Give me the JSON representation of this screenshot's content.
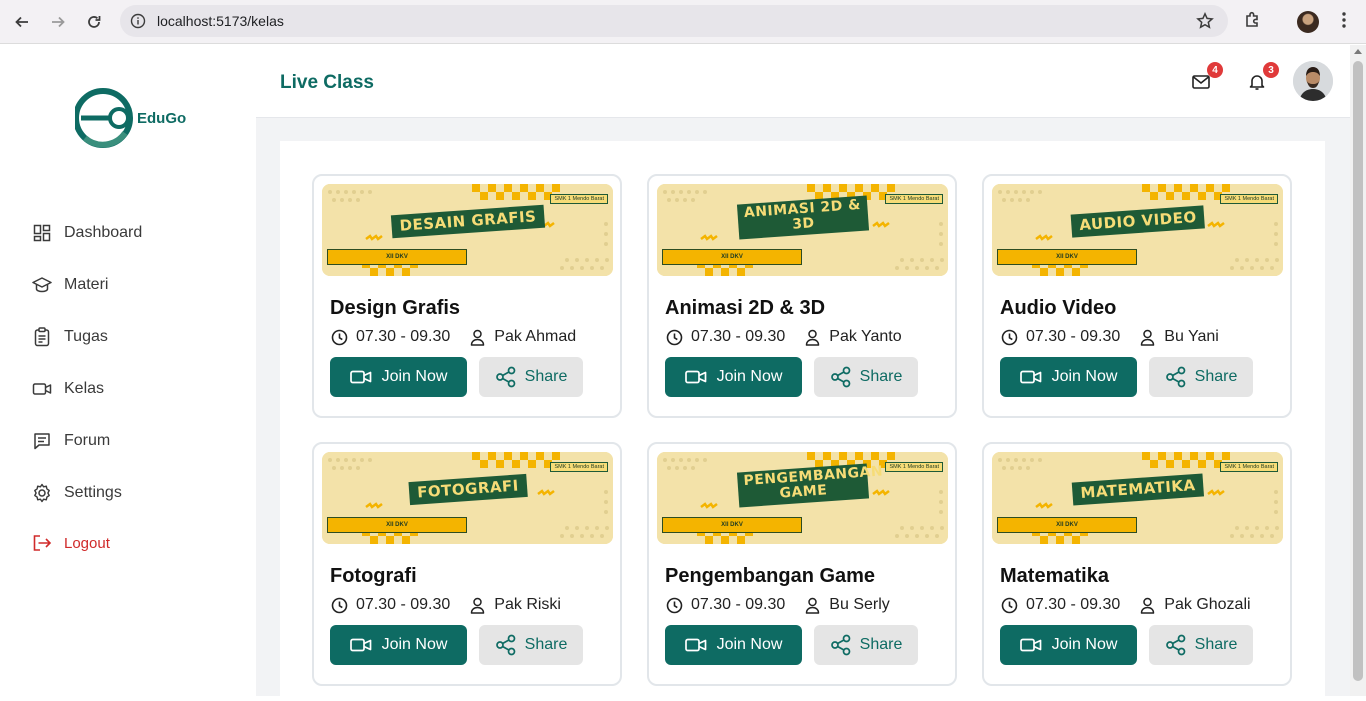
{
  "browser": {
    "url": "localhost:5173/kelas"
  },
  "brand": {
    "name": "EduGo"
  },
  "sidebar": {
    "items": [
      {
        "label": "Dashboard",
        "icon": "dashboard-icon"
      },
      {
        "label": "Materi",
        "icon": "graduation-cap-icon"
      },
      {
        "label": "Tugas",
        "icon": "clipboard-icon"
      },
      {
        "label": "Kelas",
        "icon": "video-camera-icon"
      },
      {
        "label": "Forum",
        "icon": "chat-icon"
      },
      {
        "label": "Settings",
        "icon": "gear-icon"
      }
    ],
    "logout": "Logout"
  },
  "header": {
    "title": "Live Class",
    "mail_count": "4",
    "notif_count": "3"
  },
  "colors": {
    "primary": "#0e6b63",
    "logout": "#d02a2a",
    "badge": "#e03a3a",
    "banner_bg": "#f3e2a9",
    "banner_accent": "#f4b400",
    "banner_dark": "#1e5a36"
  },
  "classes": [
    {
      "banner_title": "DESAIN GRAFIS",
      "title": "Design Grafis",
      "time": "07.30 - 09.30",
      "teacher": "Pak Ahmad",
      "school": "SMK 1 Mendo Barat",
      "class_label": "XII DKV",
      "join": "Join Now",
      "share": "Share"
    },
    {
      "banner_title": "ANIMASI 2D & 3D",
      "title": "Animasi 2D & 3D",
      "time": "07.30 - 09.30",
      "teacher": "Pak Yanto",
      "school": "SMK 1 Mendo Barat",
      "class_label": "XII DKV",
      "join": "Join Now",
      "share": "Share"
    },
    {
      "banner_title": "AUDIO VIDEO",
      "title": "Audio Video",
      "time": "07.30 - 09.30",
      "teacher": "Bu Yani",
      "school": "SMK 1 Mendo Barat",
      "class_label": "XII DKV",
      "join": "Join Now",
      "share": "Share"
    },
    {
      "banner_title": "FOTOGRAFI",
      "title": "Fotografi",
      "time": "07.30 - 09.30",
      "teacher": "Pak Riski",
      "school": "SMK 1 Mendo Barat",
      "class_label": "XII DKV",
      "join": "Join Now",
      "share": "Share"
    },
    {
      "banner_title": "PENGEMBANGAN GAME",
      "title": "Pengembangan Game",
      "time": "07.30 - 09.30",
      "teacher": "Bu Serly",
      "school": "SMK 1 Mendo Barat",
      "class_label": "XII DKV",
      "join": "Join Now",
      "share": "Share"
    },
    {
      "banner_title": "MATEMATIKA",
      "title": "Matematika",
      "time": "07.30 - 09.30",
      "teacher": "Pak Ghozali",
      "school": "SMK 1 Mendo Barat",
      "class_label": "XII DKV",
      "join": "Join Now",
      "share": "Share"
    }
  ]
}
